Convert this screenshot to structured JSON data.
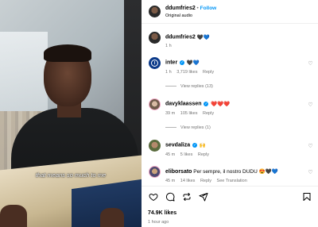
{
  "media": {
    "caption": "that means so much to me"
  },
  "header": {
    "username": "ddumfries2",
    "separator": "•",
    "follow_label": "Follow",
    "subtitle": "Original audio"
  },
  "post": {
    "username": "ddumfries2",
    "emojis": "🖤💙",
    "time": "1 h"
  },
  "comments": [
    {
      "username": "inter",
      "verified": true,
      "text": "🖤💙",
      "time": "1 h",
      "likes": "3,719 likes",
      "reply_label": "Reply",
      "view_replies": "View replies (13)"
    },
    {
      "username": "davyklaassen",
      "verified": true,
      "text": "❤️❤️❤️",
      "time": "39 m",
      "likes": "105 likes",
      "reply_label": "Reply",
      "view_replies": "View replies (1)"
    },
    {
      "username": "sevdaliza",
      "verified": true,
      "text": "🙌",
      "time": "45 m",
      "likes": "5 likes",
      "reply_label": "Reply"
    },
    {
      "username": "eliborsato",
      "verified": false,
      "text": "Per sempre, il nostro DUDU 😍🖤💙",
      "time": "45 m",
      "likes": "14 likes",
      "reply_label": "Reply",
      "translation_label": "See Translation"
    }
  ],
  "footer": {
    "likes": "74.9K likes",
    "ago": "1 hour ago"
  },
  "colors": {
    "accent": "#0095f6",
    "muted": "#737373"
  },
  "icons": [
    "heart-icon",
    "comment-icon",
    "repost-icon",
    "share-icon",
    "bookmark-icon",
    "verified-icon"
  ]
}
